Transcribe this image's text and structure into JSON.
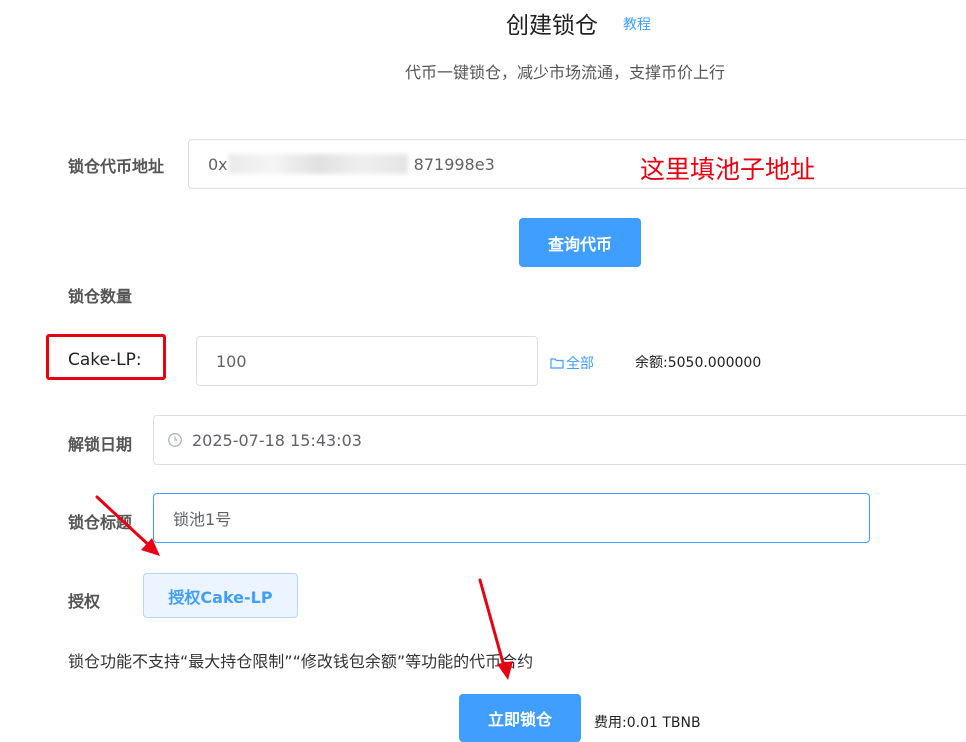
{
  "header": {
    "title": "创建锁仓",
    "tutorial_link": "教程",
    "subtitle": "代币一键锁仓，减少市场流通，支撑币价上行"
  },
  "token_address": {
    "label": "锁仓代币地址",
    "value_prefix": "0x",
    "value_suffix": "871998e3"
  },
  "annotation": {
    "text": "这里填池子地址",
    "color": "#e60012"
  },
  "query_button": {
    "label": "查询代币"
  },
  "lock_amount": {
    "label": "锁仓数量",
    "token_label": "Cake-LP:",
    "value": "100",
    "all_label": "全部",
    "balance": "余额:5050.000000"
  },
  "unlock_date": {
    "label": "解锁日期",
    "value": "2025-07-18 15:43:03"
  },
  "lock_title": {
    "label": "锁仓标题",
    "value": "锁池1号"
  },
  "authorize": {
    "label": "授权",
    "button_label": "授权Cake-LP"
  },
  "note": "锁仓功能不支持“最大持仓限制”“修改钱包余额”等功能的代币合约",
  "submit": {
    "label": "立即锁仓",
    "fee": "费用:0.01 TBNB"
  },
  "colors": {
    "primary": "#409eff",
    "annotation_red": "#e60012"
  },
  "icons": [
    "folder-icon",
    "clock-icon",
    "red-arrow-icon"
  ]
}
